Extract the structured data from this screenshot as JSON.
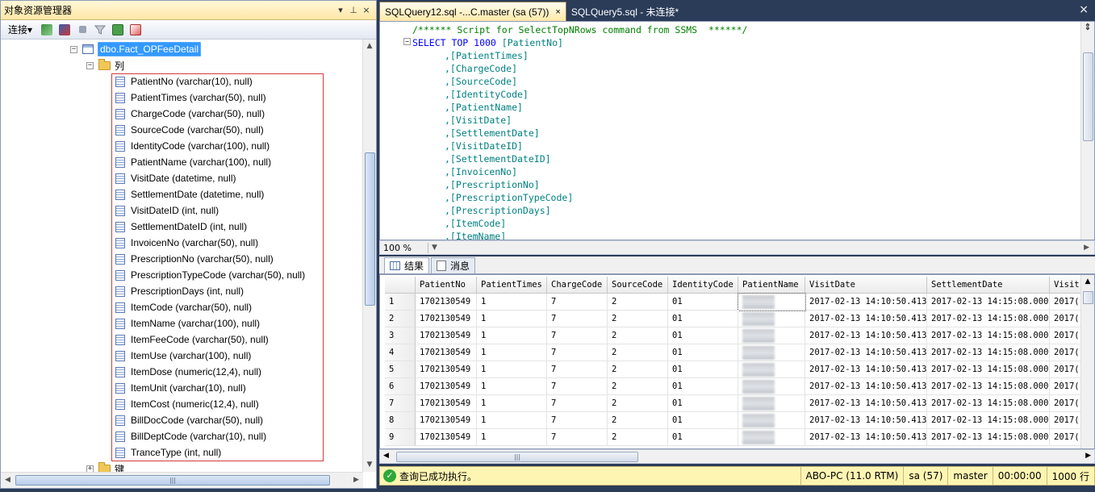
{
  "object_explorer": {
    "title": "对象资源管理器",
    "pin_glyph": "▾ ⊥",
    "close_glyph": "×",
    "toolbar": {
      "connect_label": "连接",
      "connect_arrow": "▾"
    },
    "table_node": "dbo.Fact_OPFeeDetail",
    "columns_folder": "列",
    "keys_folder": "键",
    "columns": [
      "PatientNo (varchar(10), null)",
      "PatientTimes (varchar(50), null)",
      "ChargeCode (varchar(50), null)",
      "SourceCode (varchar(50), null)",
      "IdentityCode (varchar(100), null)",
      "PatientName (varchar(100), null)",
      "VisitDate (datetime, null)",
      "SettlementDate (datetime, null)",
      "VisitDateID (int, null)",
      "SettlementDateID (int, null)",
      "InvoicenNo (varchar(50), null)",
      "PrescriptionNo (varchar(50), null)",
      "PrescriptionTypeCode (varchar(50), null)",
      "PrescriptionDays (int, null)",
      "ItemCode (varchar(50), null)",
      "ItemName (varchar(100), null)",
      "ItemFeeCode (varchar(50), null)",
      "ItemUse (varchar(100), null)",
      "ItemDose (numeric(12,4), null)",
      "ItemUnit (varchar(10), null)",
      "ItemCost (numeric(12,4), null)",
      "BillDocCode (varchar(50), null)",
      "BillDeptCode (varchar(10), null)",
      "TranceType (int, null)"
    ]
  },
  "query_tabs": [
    {
      "label": "SQLQuery12.sql -...C.master (sa (57))",
      "close": "×",
      "active": true
    },
    {
      "label": "SQLQuery5.sql - 未连接*",
      "active": false
    }
  ],
  "editor": {
    "comment": "/****** Script for SelectTopNRows command from SSMS  ******/",
    "select_kw": "SELECT TOP 1000",
    "first_col": " [PatientNo]",
    "lines": [
      ",[PatientTimes]",
      ",[ChargeCode]",
      ",[SourceCode]",
      ",[IdentityCode]",
      ",[PatientName]",
      ",[VisitDate]",
      ",[SettlementDate]",
      ",[VisitDateID]",
      ",[SettlementDateID]",
      ",[InvoicenNo]",
      ",[PrescriptionNo]",
      ",[PrescriptionTypeCode]",
      ",[PrescriptionDays]",
      ",[ItemCode]",
      ",[ItemName]"
    ],
    "zoom": "100 %"
  },
  "results_tabs": {
    "results": "结果",
    "messages": "消息"
  },
  "grid": {
    "columns": [
      "PatientNo",
      "PatientTimes",
      "ChargeCode",
      "SourceCode",
      "IdentityCode",
      "PatientName",
      "VisitDate",
      "SettlementDate",
      "Visit"
    ],
    "rows": [
      [
        "1",
        "1702130549",
        "1",
        "7",
        "2",
        "01",
        "",
        "2017-02-13 14:10:50.413",
        "2017-02-13 14:15:08.000",
        "2017("
      ],
      [
        "2",
        "1702130549",
        "1",
        "7",
        "2",
        "01",
        "",
        "2017-02-13 14:10:50.413",
        "2017-02-13 14:15:08.000",
        "2017("
      ],
      [
        "3",
        "1702130549",
        "1",
        "7",
        "2",
        "01",
        "",
        "2017-02-13 14:10:50.413",
        "2017-02-13 14:15:08.000",
        "2017("
      ],
      [
        "4",
        "1702130549",
        "1",
        "7",
        "2",
        "01",
        "",
        "2017-02-13 14:10:50.413",
        "2017-02-13 14:15:08.000",
        "2017("
      ],
      [
        "5",
        "1702130549",
        "1",
        "7",
        "2",
        "01",
        "",
        "2017-02-13 14:10:50.413",
        "2017-02-13 14:15:08.000",
        "2017("
      ],
      [
        "6",
        "1702130549",
        "1",
        "7",
        "2",
        "01",
        "",
        "2017-02-13 14:10:50.413",
        "2017-02-13 14:15:08.000",
        "2017("
      ],
      [
        "7",
        "1702130549",
        "1",
        "7",
        "2",
        "01",
        "",
        "2017-02-13 14:10:50.413",
        "2017-02-13 14:15:08.000",
        "2017("
      ],
      [
        "8",
        "1702130549",
        "1",
        "7",
        "2",
        "01",
        "",
        "2017-02-13 14:10:50.413",
        "2017-02-13 14:15:08.000",
        "2017("
      ],
      [
        "9",
        "1702130549",
        "1",
        "7",
        "2",
        "01",
        "",
        "2017-02-13 14:10:50.413",
        "2017-02-13 14:15:08.000",
        "2017("
      ]
    ]
  },
  "status": {
    "message": "查询已成功执行。",
    "server": "ABO-PC (11.0 RTM)",
    "user": "sa (57)",
    "database": "master",
    "elapsed": "00:00:00",
    "rows": "1000 行"
  }
}
